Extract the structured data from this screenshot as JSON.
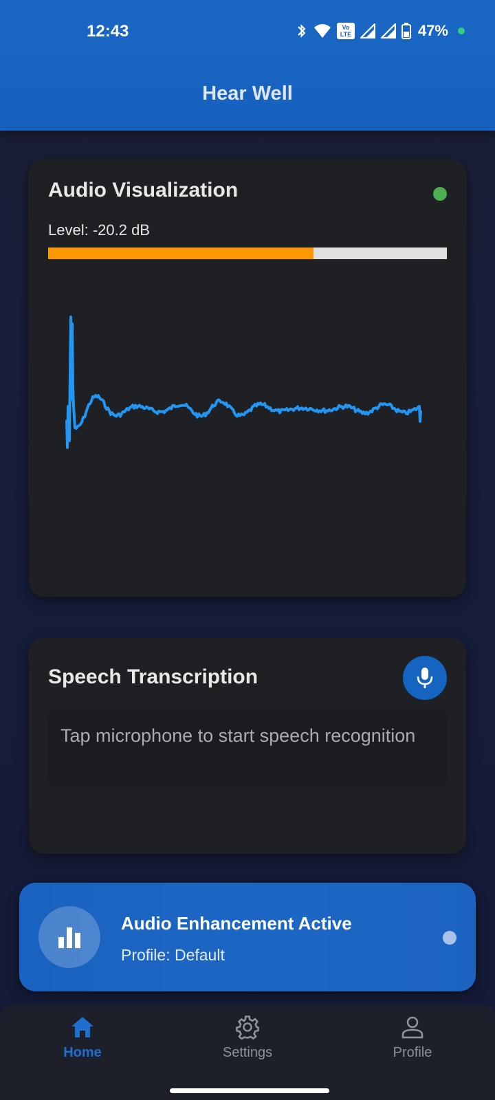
{
  "status_bar": {
    "time": "12:43",
    "battery": "47%",
    "volte_label": "Vo LTE"
  },
  "header": {
    "title": "Hear Well"
  },
  "audio_visualization": {
    "title": "Audio Visualization",
    "level_label": "Level: -20.2 dB",
    "level_fraction": 0.665,
    "status_color": "#4caf50",
    "bar_color": "#ff9800",
    "wave_color": "#2196f3"
  },
  "speech": {
    "title": "Speech Transcription",
    "placeholder": "Tap microphone to start speech recognition"
  },
  "enhancement": {
    "title": "Audio Enhancement Active",
    "profile": "Profile: Default"
  },
  "nav": {
    "items": [
      {
        "label": "Home",
        "icon": "home-icon",
        "active": true
      },
      {
        "label": "Settings",
        "icon": "gear-icon",
        "active": false
      },
      {
        "label": "Profile",
        "icon": "person-icon",
        "active": false
      }
    ]
  },
  "colors": {
    "accent": "#1565c0",
    "nav_active": "#1e6fd0"
  }
}
